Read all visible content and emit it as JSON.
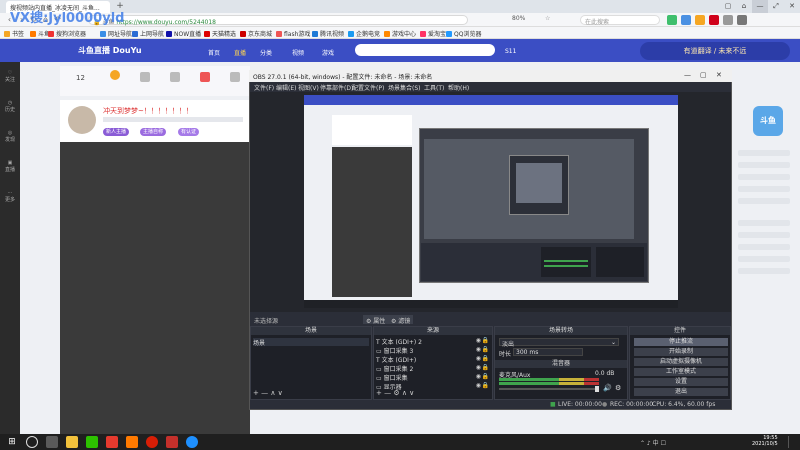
{
  "watermark": "VX搜:Jyl0000yld",
  "browser": {
    "tab_title": "搜视频站内直播_冰凌无间_斗鱼...",
    "new_tab": "+",
    "window_controls": [
      "▢",
      "⌂",
      "—",
      "⤢",
      "✕"
    ],
    "url": "https://www.douyu.com/5244018",
    "url_prefix": "🔒 斗鱼",
    "zoom": "80%",
    "search_placeholder": "在此搜索",
    "bookmarks": [
      "书签",
      "斗鱼",
      "搜狗浏览器",
      "网址导航",
      "上网导航",
      "NOW直播",
      "天猫精选",
      "京东商城",
      "flash游戏",
      "腾讯视频",
      "企鹅电竞",
      "游戏中心",
      "爱淘宝",
      "QQ浏览器"
    ]
  },
  "site": {
    "logo": "斗鱼直播 DouYu",
    "nav": [
      "首页",
      "直播",
      "分类",
      "视频",
      "游戏",
      "S11"
    ],
    "banner": "有道翻译 / 未来不远",
    "strip_count": "12",
    "anchor_title": "冲天到梦梦~！！！！！！！",
    "tags": [
      "新人主播",
      "主播自称",
      "有认证"
    ],
    "rail_items": [
      "关注",
      "历史",
      "发现",
      "直播",
      "更多"
    ],
    "mascot": "斗鱼"
  },
  "obs": {
    "title": "OBS 27.0.1 (64-bit, windows) - 配置文件: 未命名 - 场景: 未命名",
    "menu": [
      "文件(F)",
      "编辑(E)",
      "视图(V)",
      "停靠部件(D)",
      "配置文件(P)",
      "场景集合(S)",
      "工具(T)",
      "帮助(H)"
    ],
    "source_bar_label": "未选择源",
    "source_bar_buttons": [
      "⚙ 属性",
      "⚙ 滤镜"
    ],
    "docks": {
      "scenes": "场景",
      "sources": "来源",
      "mixer": "混音器",
      "transitions": "场景转场",
      "controls": "控件"
    },
    "scene_items": [
      "场景"
    ],
    "source_items": [
      {
        "icon": "T",
        "name": "文本 (GDI+) 2"
      },
      {
        "icon": "▭",
        "name": "窗口采集 3"
      },
      {
        "icon": "T",
        "name": "文本 (GDI+)"
      },
      {
        "icon": "▭",
        "name": "窗口采集 2"
      },
      {
        "icon": "▭",
        "name": "窗口采集"
      },
      {
        "icon": "▭",
        "name": "显示器"
      }
    ],
    "dock_footer": "+  —  ∧  ∨",
    "sources_footer": "+  —  ⚙  ∧  ∨",
    "transition": {
      "type": "淡出",
      "duration_label": "时长",
      "duration": "300 ms"
    },
    "mixer": {
      "track": "麦克风/Aux",
      "db": "0.0 dB"
    },
    "controls": [
      "停止推流",
      "开始录制",
      "启动虚拟摄像机",
      "工作室模式",
      "设置",
      "退出"
    ],
    "status": {
      "live": "LIVE: 00:00:00",
      "rec": "REC: 00:00:00",
      "cpu": "CPU: 6.4%, 60.00 fps"
    }
  },
  "taskbar": {
    "tray": "⌃  ♪  中  ☐",
    "time": "19:55",
    "date": "2021/10/5"
  },
  "colors": {
    "douyu_blue": "#3b4ec4",
    "obs_dark": "#2b2e38",
    "anchor_red": "#dd3333"
  }
}
